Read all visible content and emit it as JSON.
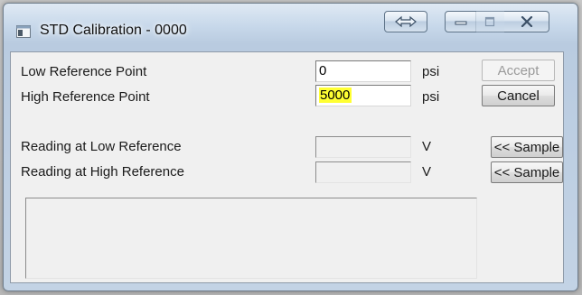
{
  "window": {
    "title": "STD Calibration - 0000",
    "app_icon": "window-app-icon",
    "controls": [
      "swap-icon",
      "minimize-icon",
      "maximize-icon",
      "close-icon"
    ]
  },
  "form": {
    "low_ref": {
      "label": "Low Reference Point",
      "value": "0",
      "unit": "psi"
    },
    "high_ref": {
      "label": "High Reference Point",
      "value": "5000",
      "unit": "psi",
      "highlight": "#ffff33"
    },
    "low_reading": {
      "label": "Reading at Low Reference",
      "value": "",
      "unit": "V"
    },
    "high_reading": {
      "label": "Reading at High Reference",
      "value": "",
      "unit": "V"
    }
  },
  "buttons": {
    "accept": "Accept",
    "cancel": "Cancel",
    "sample_low": "<< Sample",
    "sample_high": "<< Sample"
  },
  "message": ""
}
